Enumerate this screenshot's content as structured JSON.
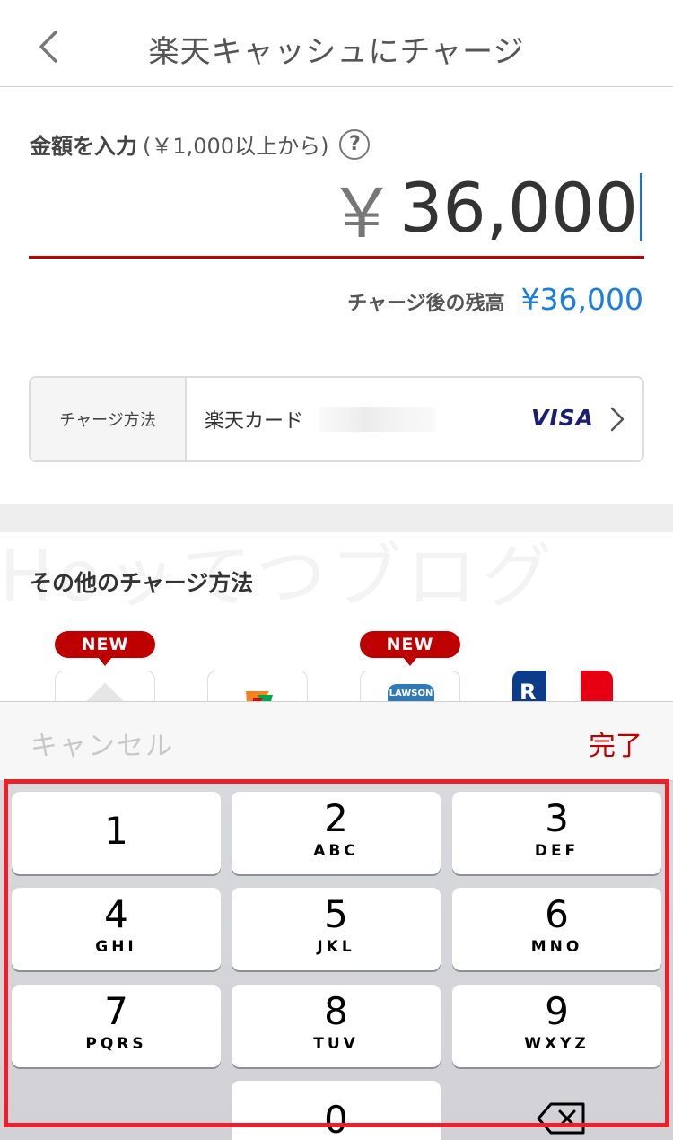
{
  "nav": {
    "title": "楽天キャッシュにチャージ",
    "back_icon": "chevron-left-icon"
  },
  "amount": {
    "label": "金額を入力",
    "note": "(￥1,000以上から)",
    "help_icon": "?",
    "yen": "￥",
    "value": "36,000"
  },
  "balance": {
    "label": "チャージ後の残高",
    "value": "¥36,000"
  },
  "charge_method": {
    "header": "チャージ方法",
    "card_name": "楽天カード",
    "brand": "VISA"
  },
  "other": {
    "title": "その他のチャージ方法",
    "watermark": "Hoッてつブログ",
    "badges": [
      "NEW",
      "NEW"
    ],
    "lawson_label": "LAWSON",
    "rakuten_letter": "R"
  },
  "toolbar": {
    "cancel": "キャンセル",
    "done": "完了"
  },
  "keypad": {
    "keys": [
      {
        "num": "1",
        "letters": ""
      },
      {
        "num": "2",
        "letters": "ABC"
      },
      {
        "num": "3",
        "letters": "DEF"
      },
      {
        "num": "4",
        "letters": "GHI"
      },
      {
        "num": "5",
        "letters": "JKL"
      },
      {
        "num": "6",
        "letters": "MNO"
      },
      {
        "num": "7",
        "letters": "PQRS"
      },
      {
        "num": "8",
        "letters": "TUV"
      },
      {
        "num": "9",
        "letters": "WXYZ"
      },
      {
        "num": "0",
        "letters": ""
      }
    ]
  },
  "colors": {
    "accent_red": "#bf0000",
    "balance_blue": "#1a7ee0",
    "highlight": "#e8222d"
  }
}
